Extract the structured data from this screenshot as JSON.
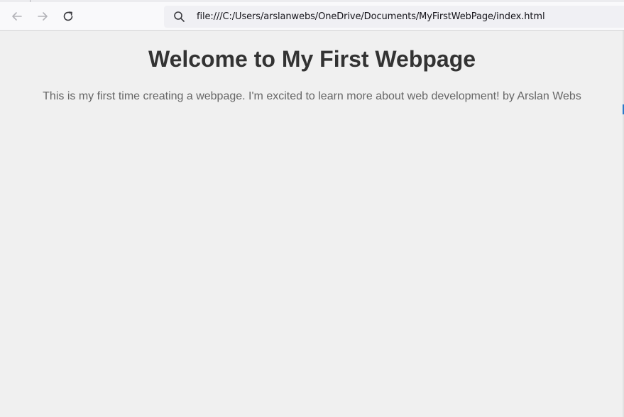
{
  "browser": {
    "url": "file:///C:/Users/arslanwebs/OneDrive/Documents/MyFirstWebPage/index.html",
    "icons": {
      "back": "arrow-left-icon",
      "forward": "arrow-right-icon",
      "reload": "reload-icon",
      "search": "search-icon"
    }
  },
  "page": {
    "heading": "Welcome to My First Webpage",
    "paragraph": "This is my first time creating a webpage. I'm excited to learn more about web development! by Arslan Webs"
  },
  "colors": {
    "page_background": "#f0f0f0",
    "heading": "#333333",
    "paragraph": "#666666",
    "toolbar": "#f9f9fb",
    "url_bar": "#f0f0f4",
    "accent": "#2a7ac9"
  }
}
